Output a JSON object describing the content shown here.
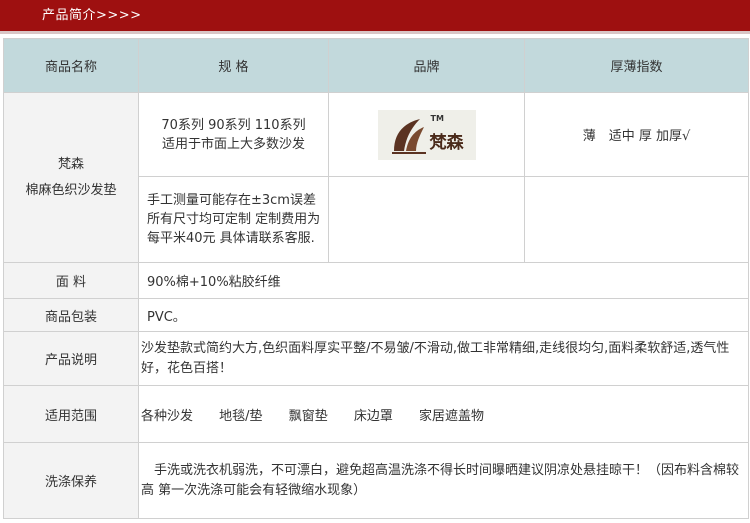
{
  "header": {
    "title": "产品简介>>>>"
  },
  "table": {
    "headers": [
      "商品名称",
      "规 格",
      "品牌",
      "厚薄指数"
    ],
    "product_name_line1": "梵森",
    "product_name_line2": "棉麻色织沙发垫",
    "spec_line1": "70系列 90系列 110系列",
    "spec_line2": "适用于市面上大多数沙发",
    "note_line1": "手工测量可能存在±3cm误差",
    "note_line2": "所有尺寸均可定制 定制费用为",
    "note_line3": "每平米40元 具体请联系客服.",
    "brand_name": "梵森",
    "brand_tm": "TM",
    "thickness": "薄　适中  厚  加厚√",
    "rows": [
      {
        "label": "面 料",
        "value": "90%棉+10%粘胶纤维"
      },
      {
        "label": "商品包装",
        "value": "PVC。"
      },
      {
        "label": "产品说明",
        "value": "沙发垫款式简约大方,色织面料厚实平整/不易皱/不滑动,做工非常精细,走线很均匀,面料柔软舒适,透气性好，花色百搭！"
      },
      {
        "label": "适用范围",
        "items": [
          "各种沙发",
          "地毯/垫",
          "飘窗垫",
          "床边罩",
          "家居遮盖物"
        ]
      },
      {
        "label": "洗涤保养",
        "value": "　手洗或洗衣机弱洗，不可漂白，避免超高温洗涤不得长时间曝晒建议阴凉处悬挂晾干！（因布料含棉较高 第一次洗涤可能会有轻微缩水现象）"
      }
    ]
  },
  "colors": {
    "header_bg": "#9e1010",
    "table_header_bg": "#c2d9dc",
    "label_bg": "#f3f3f3",
    "border": "#d0d0d0"
  }
}
